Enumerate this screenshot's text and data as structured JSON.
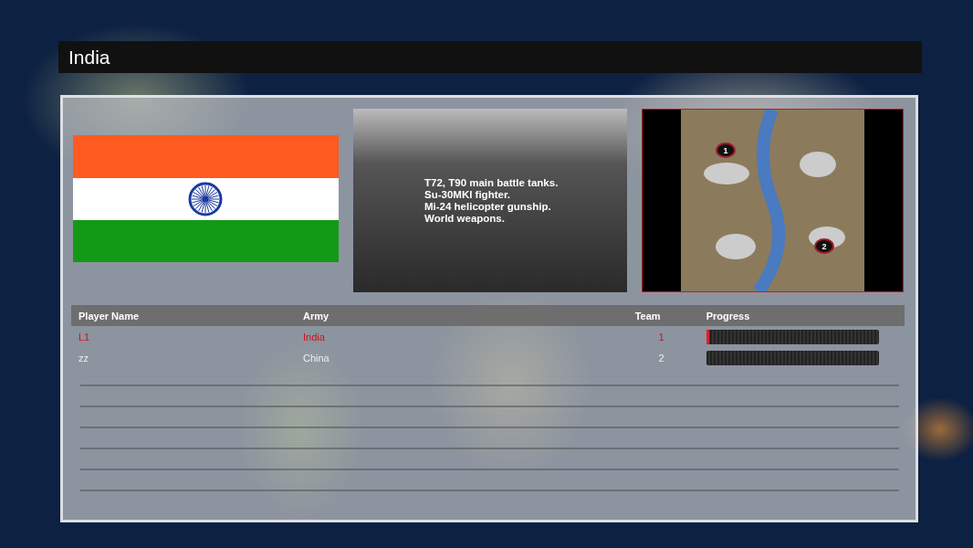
{
  "title": "India",
  "faction_description": [
    "T72, T90 main battle tanks.",
    "Su-30MKI fighter.",
    "Mi-24 helicopter gunship.",
    "World weapons."
  ],
  "map_preview": {
    "start_positions": [
      "1",
      "2"
    ]
  },
  "players_table": {
    "columns": [
      "Player Name",
      "Army",
      "Team",
      "Progress"
    ],
    "rows": [
      {
        "player_name": "L1",
        "army": "India",
        "team": "1",
        "local": true,
        "level": 0.02
      },
      {
        "player_name": "zz",
        "army": "China",
        "team": "2",
        "local": false
      }
    ]
  }
}
